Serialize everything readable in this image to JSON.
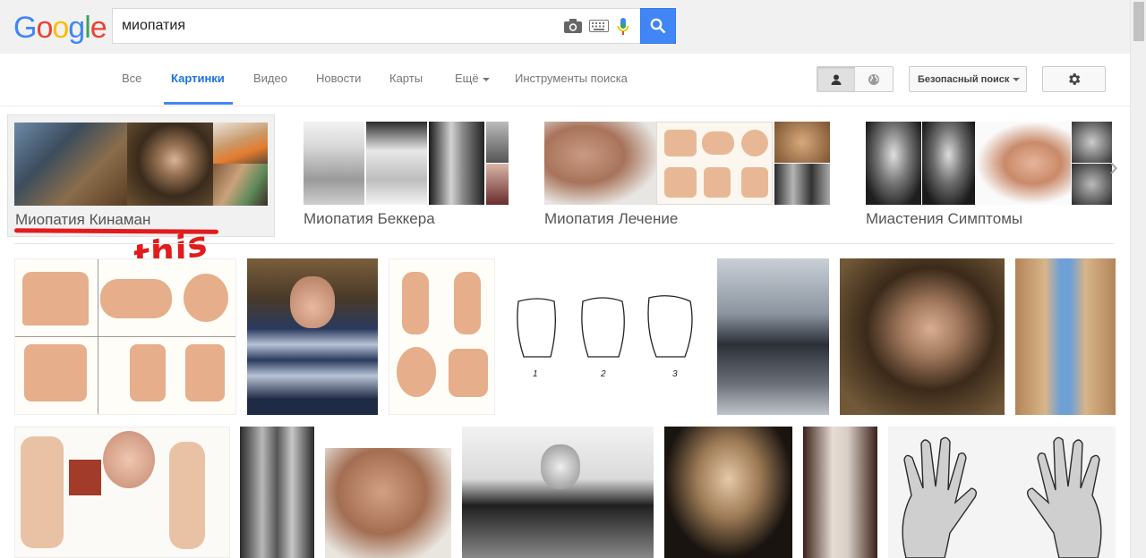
{
  "logo": {
    "letters": [
      "G",
      "o",
      "o",
      "g",
      "l",
      "e"
    ]
  },
  "search": {
    "query": "миопатия"
  },
  "tabs": [
    {
      "label": "Все"
    },
    {
      "label": "Картинки"
    },
    {
      "label": "Видео"
    },
    {
      "label": "Новости"
    },
    {
      "label": "Карты"
    },
    {
      "label": "Ещё"
    },
    {
      "label": "Инструменты поиска"
    }
  ],
  "safe_search": {
    "label": "Безопасный поиск"
  },
  "related": [
    {
      "label": "Миопатия Кинаман"
    },
    {
      "label": "Миопатия Беккера"
    },
    {
      "label": "Миопатия Лечение"
    },
    {
      "label": "Миастения Симптомы"
    }
  ],
  "annotation": {
    "text": "this"
  },
  "colors": {
    "accent": "#4285f4",
    "annotation": "#e21b1b"
  }
}
